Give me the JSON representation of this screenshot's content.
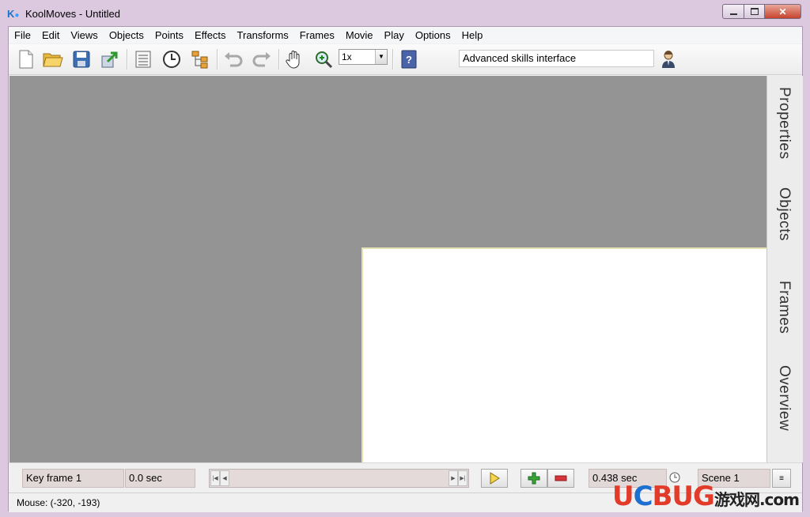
{
  "window": {
    "title": "KoolMoves - Untitled",
    "app_icon": "koolmoves-icon"
  },
  "window_buttons": {
    "minimize": "—",
    "maximize": "▢",
    "close": "✕"
  },
  "menu": [
    "File",
    "Edit",
    "Views",
    "Objects",
    "Points",
    "Effects",
    "Transforms",
    "Frames",
    "Movie",
    "Play",
    "Options",
    "Help"
  ],
  "toolbar": {
    "icons": [
      "new-file-icon",
      "open-folder-icon",
      "save-icon",
      "export-icon",
      "properties-icon",
      "clock-icon",
      "tree-icon",
      "undo-icon",
      "redo-icon",
      "hand-icon",
      "zoom-icon",
      "help-book-icon",
      "user-icon"
    ],
    "zoom_value": "1x",
    "mode_label": "Advanced skills interface"
  },
  "side_tabs": [
    "Properties",
    "Objects",
    "Frames",
    "Overview"
  ],
  "timeline": {
    "keyframe_label": "Key frame 1",
    "time": "0.0 sec",
    "duration": "0.438 sec",
    "scene_label": "Scene 1"
  },
  "status": {
    "mouse": "Mouse: (-320, -193)"
  },
  "watermark": {
    "brand_u": "U",
    "brand_c": "C",
    "brand_bug": "BUG",
    "cn": "游戏网",
    "domain": ".com"
  },
  "colors": {
    "workspace": "#949494",
    "stage": "#ffffff",
    "accent": "#1a73c9"
  }
}
